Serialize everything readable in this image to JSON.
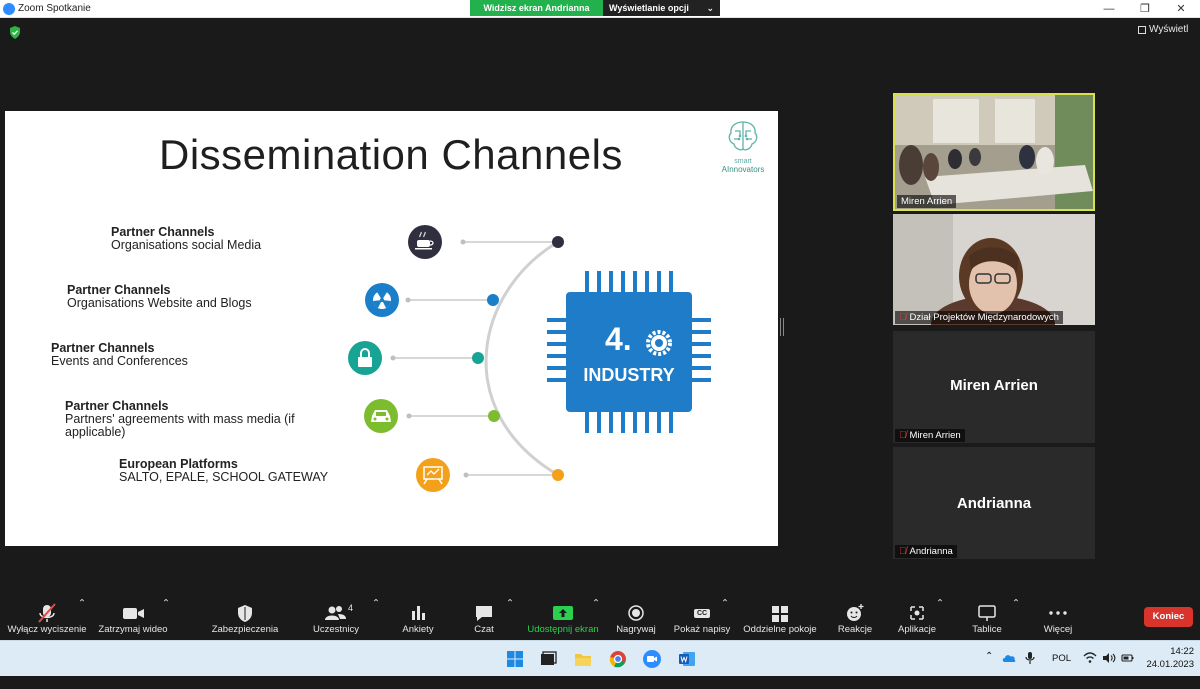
{
  "window": {
    "title": "Zoom Spotkanie",
    "banner_status": "Widzisz ekran Andrianna",
    "banner_options": "Wyświetlanie opcji",
    "view_label": "Wyświetl"
  },
  "slide": {
    "title": "Dissemination Channels",
    "logo_line1": "smart",
    "logo_line2": "AInnovators",
    "chip_number": "4.",
    "chip_label": "INDUSTRY",
    "channels": [
      {
        "title": "Partner Channels",
        "desc": "Organisations social Media",
        "color": "#2f2f3f"
      },
      {
        "title": "Partner Channels",
        "desc": "Organisations Website and Blogs",
        "color": "#1a7fc8"
      },
      {
        "title": "Partner Channels",
        "desc": "Events and Conferences",
        "color": "#18a494"
      },
      {
        "title": "Partner Channels",
        "desc": "Partners' agreements with mass media (if applicable)",
        "color": "#7dbb2f"
      },
      {
        "title": "European Platforms",
        "desc": "SALTO, EPALE, SCHOOL GATEWAY",
        "color": "#f3a11b"
      }
    ],
    "colors": {
      "chip": "#1e7cc8",
      "line": "#bfbfbf"
    }
  },
  "participants": [
    {
      "name": "Miren Arrien",
      "muted": false,
      "video": true
    },
    {
      "name": "Dział Projektów Międzynarodowych",
      "muted": true,
      "video": true
    },
    {
      "name": "Miren Arrien",
      "muted": true,
      "video": false,
      "big_name": "Miren Arrien"
    },
    {
      "name": "Andrianna",
      "muted": true,
      "video": false,
      "big_name": "Andrianna"
    }
  ],
  "toolbar": {
    "mute": "Wyłącz wyciszenie",
    "video": "Zatrzymaj wideo",
    "security": "Zabezpieczenia",
    "participants": "Uczestnicy",
    "participants_count": "4",
    "polls": "Ankiety",
    "chat": "Czat",
    "share": "Udostępnij ekran",
    "record": "Nagrywaj",
    "captions": "Pokaż napisy",
    "captions_icon_text": "CC",
    "breakout": "Oddzielne pokoje",
    "reactions": "Reakcje",
    "apps": "Aplikacje",
    "whiteboard": "Tablice",
    "more": "Więcej",
    "end": "Koniec"
  },
  "taskbar": {
    "language": "POL",
    "time": "14:22",
    "date": "24.01.2023"
  }
}
